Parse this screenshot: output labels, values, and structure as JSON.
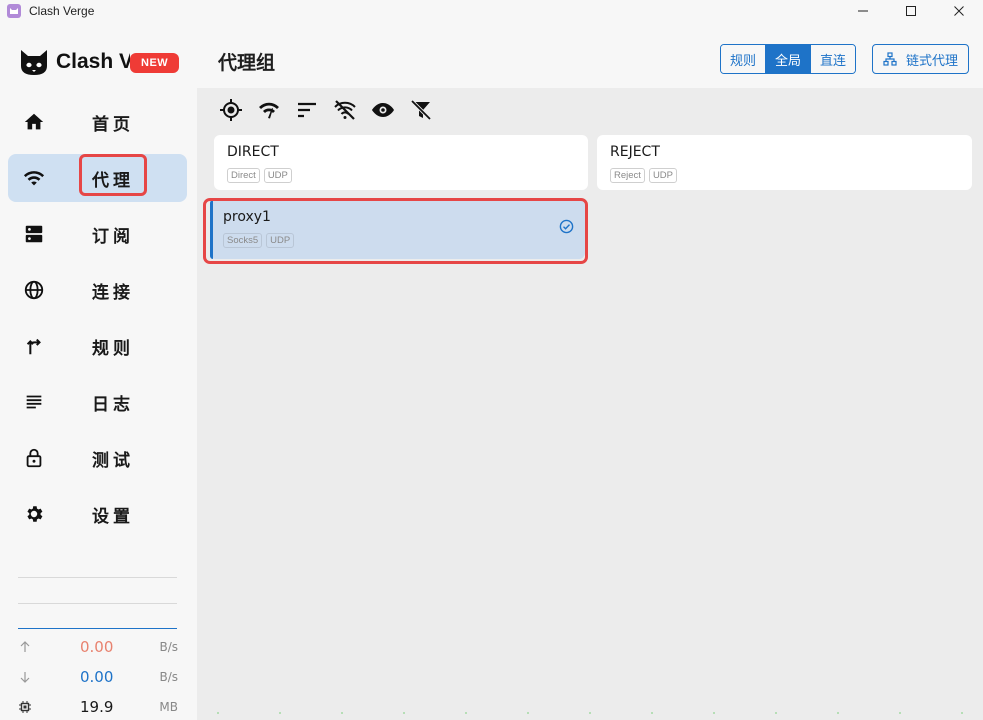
{
  "window": {
    "title": "Clash Verge"
  },
  "sidebar": {
    "logo_text": "Clash V",
    "new_badge": "NEW",
    "items": [
      {
        "label": "首页",
        "icon": "home-icon",
        "active": false
      },
      {
        "label": "代理",
        "icon": "wifi-icon",
        "active": true
      },
      {
        "label": "订阅",
        "icon": "server-icon",
        "active": false
      },
      {
        "label": "连接",
        "icon": "globe-icon",
        "active": false
      },
      {
        "label": "规则",
        "icon": "fork-arrow-icon",
        "active": false
      },
      {
        "label": "日志",
        "icon": "list-icon",
        "active": false
      },
      {
        "label": "测试",
        "icon": "lock-icon",
        "active": false
      },
      {
        "label": "设置",
        "icon": "gear-icon",
        "active": false
      }
    ],
    "traffic": {
      "upload_value": "0.00",
      "upload_unit": "B/s",
      "download_value": "0.00",
      "download_unit": "B/s",
      "memory_value": "19.9",
      "memory_unit": "MB"
    }
  },
  "header": {
    "title": "代理组",
    "modes": [
      "规则",
      "全局",
      "直连"
    ],
    "active_mode": "全局",
    "chain_label": "链式代理"
  },
  "toolbar": {
    "icons": [
      "locate-icon",
      "wifi-speed-icon",
      "sort-icon",
      "wifi-off-icon",
      "eye-icon",
      "filter-off-icon"
    ]
  },
  "proxies": [
    {
      "name": "DIRECT",
      "tags": [
        "Direct",
        "UDP"
      ],
      "selected": false
    },
    {
      "name": "REJECT",
      "tags": [
        "Reject",
        "UDP"
      ],
      "selected": false
    },
    {
      "name": "proxy1",
      "tags": [
        "Socks5",
        "UDP"
      ],
      "selected": true
    }
  ],
  "colors": {
    "accent": "#1e73c8",
    "active_nav_bg": "#cfe0f2",
    "highlight": "#e64646",
    "upload": "#e8826f",
    "download": "#1e73c8"
  }
}
